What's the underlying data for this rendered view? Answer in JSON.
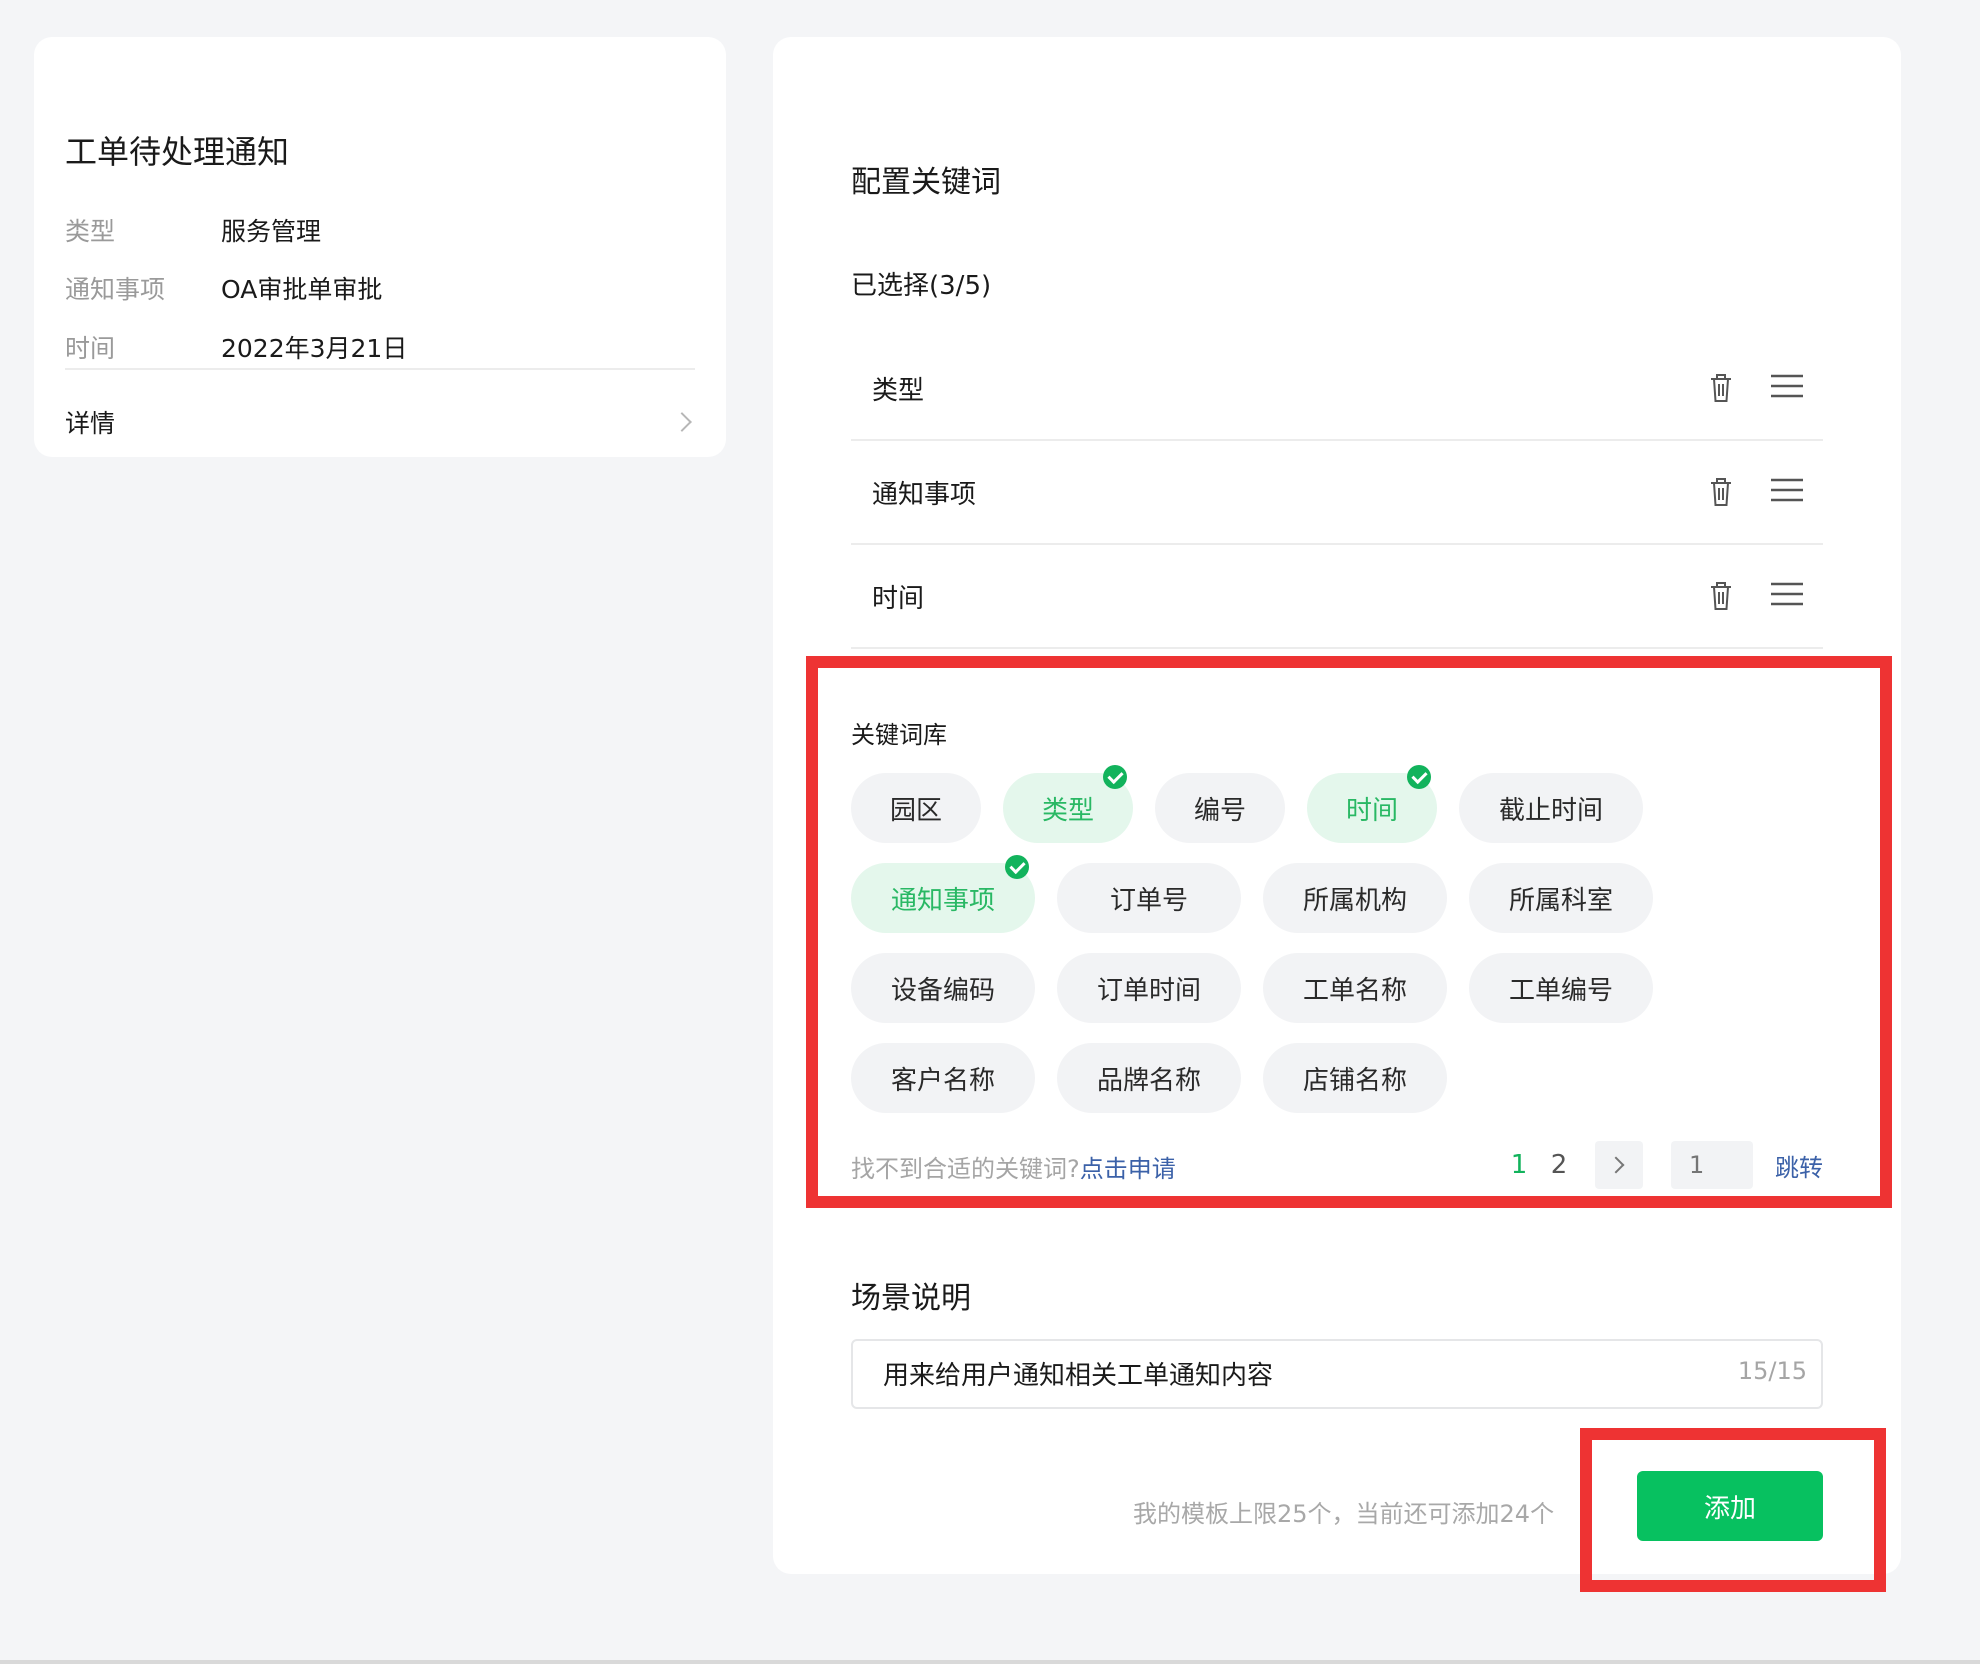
{
  "preview": {
    "title": "工单待处理通知",
    "fields": [
      {
        "key": "类型",
        "value": "服务管理"
      },
      {
        "key": "通知事项",
        "value": "OA审批单审批"
      },
      {
        "key": "时间",
        "value": "2022年3月21日"
      }
    ],
    "detail_label": "详情"
  },
  "config": {
    "heading": "配置关键词",
    "selected_label": "已选择(3/5)",
    "selected": [
      "类型",
      "通知事项",
      "时间"
    ]
  },
  "library": {
    "label": "关键词库",
    "rows": [
      [
        {
          "text": "园区",
          "selected": false
        },
        {
          "text": "类型",
          "selected": true
        },
        {
          "text": "编号",
          "selected": false
        },
        {
          "text": "时间",
          "selected": true
        },
        {
          "text": "截止时间",
          "selected": false
        }
      ],
      [
        {
          "text": "通知事项",
          "selected": true
        },
        {
          "text": "订单号",
          "selected": false
        },
        {
          "text": "所属机构",
          "selected": false
        },
        {
          "text": "所属科室",
          "selected": false
        }
      ],
      [
        {
          "text": "设备编码",
          "selected": false
        },
        {
          "text": "订单时间",
          "selected": false
        },
        {
          "text": "工单名称",
          "selected": false
        },
        {
          "text": "工单编号",
          "selected": false
        }
      ],
      [
        {
          "text": "客户名称",
          "selected": false
        },
        {
          "text": "品牌名称",
          "selected": false
        },
        {
          "text": "店铺名称",
          "selected": false
        }
      ]
    ],
    "hint": "找不到合适的关键词?",
    "apply_link": "点击申请",
    "pages": [
      "1",
      "2"
    ],
    "current_page": "1",
    "page_input_placeholder": "1",
    "jump_label": "跳转"
  },
  "scene": {
    "heading": "场景说明",
    "value": "用来给用户通知相关工单通知内容",
    "count": "15/15"
  },
  "footer": {
    "limit_text": "我的模板上限25个，当前还可添加24个",
    "add_label": "添加"
  },
  "colors": {
    "brand_green": "#07c160",
    "selected_tag_bg": "#e4f7ec",
    "link_blue": "#3b61a8",
    "annotation_red": "#ee3333"
  }
}
